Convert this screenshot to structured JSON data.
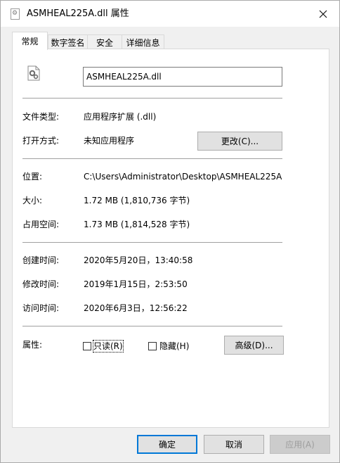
{
  "window": {
    "title": "ASMHEAL225A.dll 属性"
  },
  "tabs": [
    "常规",
    "数字签名",
    "安全",
    "详细信息"
  ],
  "general": {
    "file_name": "ASMHEAL225A.dll",
    "type_label": "文件类型:",
    "type_value": "应用程序扩展 (.dll)",
    "opens_label": "打开方式:",
    "opens_value": "未知应用程序",
    "change_button": "更改(C)...",
    "location_label": "位置:",
    "location_value": "C:\\Users\\Administrator\\Desktop\\ASMHEAL225A",
    "size_label": "大小:",
    "size_value": "1.72 MB (1,810,736 字节)",
    "disk_label": "占用空间:",
    "disk_value": "1.73 MB (1,814,528 字节)",
    "created_label": "创建时间:",
    "created_value": "2020年5月20日，13:40:58",
    "modified_label": "修改时间:",
    "modified_value": "2019年1月15日，2:53:50",
    "accessed_label": "访问时间:",
    "accessed_value": "2020年6月3日，12:56:22",
    "attributes_label": "属性:",
    "readonly_label": "只读(R)",
    "readonly_checked": false,
    "hidden_label": "隐藏(H)",
    "hidden_checked": false,
    "advanced_button": "高级(D)..."
  },
  "footer": {
    "ok": "确定",
    "cancel": "取消",
    "apply": "应用(A)"
  },
  "icons": {
    "title": "dll-file-icon",
    "close": "close-icon",
    "file": "gear-file-icon"
  }
}
